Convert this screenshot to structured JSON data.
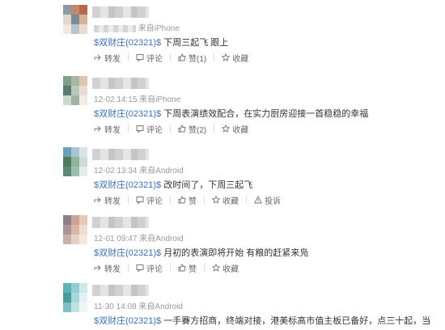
{
  "posts": [
    {
      "meta_suffix": "来自iPhone",
      "time": "",
      "stock": "$双财庄(02321)$",
      "text": "下周三起飞 跟上",
      "actions": {
        "forward": "转发",
        "comment": "评论",
        "like": "赞(1)",
        "favorite": "收藏",
        "report": ""
      },
      "avatar_colors": [
        "#8a9aa8",
        "#c08a6a",
        "#b36a4f",
        "#e1d7cf",
        "#7b8b95",
        "#d7b29a",
        "#f0e8e2",
        "#b8c3cb",
        "#e9ddd2"
      ]
    },
    {
      "meta_suffix": "来自iPhone",
      "time": "12-02 14:15",
      "stock": "$双财庄(02321)$",
      "text": "下周表演绩效配合，在实力厨房迎接一首稳稳的幸福",
      "actions": {
        "forward": "转发",
        "comment": "评论",
        "like": "赞(2)",
        "favorite": "收藏",
        "report": ""
      },
      "avatar_colors": [
        "#7fa08c",
        "#a6b8a2",
        "#d9c6b4",
        "#5e7a6b",
        "#b7c9bb",
        "#e6ded4",
        "#cfd8d0",
        "#9fb3a6",
        "#f1ece5"
      ]
    },
    {
      "meta_suffix": "来自Android",
      "time": "12-02 13:34",
      "stock": "$双财庄(02321)$",
      "text": "改时间了，下周三起飞",
      "actions": {
        "forward": "转发",
        "comment": "评论",
        "like": "赞",
        "favorite": "收藏",
        "report": "投诉"
      },
      "avatar_colors": [
        "#6f9fb8",
        "#a8c6d2",
        "#d7e4e9",
        "#4f7c5a",
        "#8fb49a",
        "#c9ddd0",
        "#5c8a72",
        "#9bbfae",
        "#e3ece6"
      ]
    },
    {
      "meta_suffix": "来自Android",
      "time": "12-01 09:47",
      "stock": "$双财庄(02321)$",
      "text": "月初的表演即将开始 有粮的赶紧来凫",
      "actions": {
        "forward": "转发",
        "comment": "评论",
        "like": "赞",
        "favorite": "收藏",
        "report": ""
      },
      "avatar_colors": [
        "#8c7f86",
        "#c9a59a",
        "#e8c6b4",
        "#a8949a",
        "#d9b7a3",
        "#f0dccf",
        "#c7b1a8",
        "#e5cfc1",
        "#f4e7df"
      ]
    },
    {
      "meta_suffix": "来自Android",
      "time": "11-30 14:08",
      "stock": "$双财庄(02321)$",
      "text": "一手賽方招商，终端对接，港美标高市值主板已备好，点三十起，当",
      "actions": {
        "forward": "",
        "comment": "",
        "like": "",
        "favorite": "",
        "report": ""
      },
      "avatar_colors": [
        "#5fb3b8",
        "#8fcfd1",
        "#cde9ea",
        "#4a9aa0",
        "#a7d7d9",
        "#e2f2f2",
        "#7fc0c4",
        "#bfe3e4",
        "#eef7f7"
      ]
    }
  ]
}
